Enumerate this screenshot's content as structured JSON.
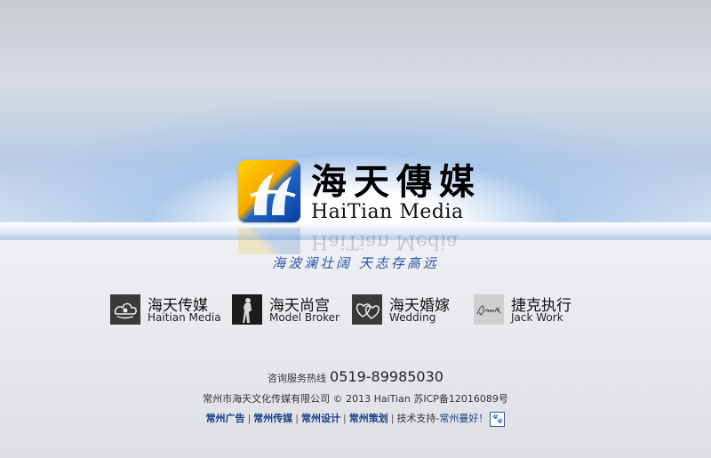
{
  "logo": {
    "cn": "海天傳媒",
    "en": "HaiTian Media"
  },
  "slogan": "海波澜壮阔   天志存高远",
  "nav": [
    {
      "cn": "海天传媒",
      "en": "Haitian Media",
      "icon": "cloud-emblem-icon"
    },
    {
      "cn": "海天尚宫",
      "en": "Model Broker",
      "icon": "model-silhouette-icon"
    },
    {
      "cn": "海天婚嫁",
      "en": "Wedding",
      "icon": "rings-icon"
    },
    {
      "cn": "捷克执行",
      "en": "Jack Work",
      "icon": "jack-signature-icon"
    }
  ],
  "footer": {
    "hotline_label": "咨询服务热线",
    "hotline_number": "0519-89985030",
    "copyright": "常州市海天文化传媒有限公司 © 2013 HaiTian   苏ICP备12016089号",
    "links": [
      "常州广告",
      "常州传媒",
      "常州设计",
      "常州策划"
    ],
    "support_label": "技术支持-",
    "support_link": "常州曼好！"
  },
  "colors": {
    "slogan": "#2a56a8",
    "link": "#1a3c8a"
  }
}
